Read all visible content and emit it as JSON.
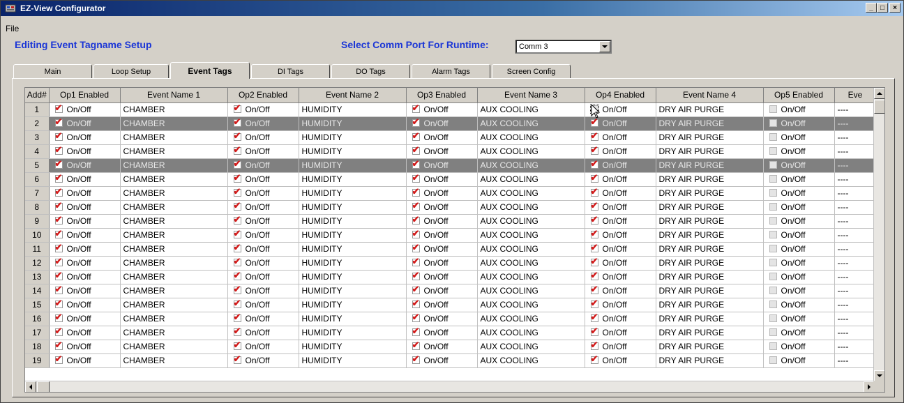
{
  "window": {
    "title": "EZ-View Configurator",
    "min": "_",
    "max": "□",
    "close": "×"
  },
  "menu": {
    "file": "File"
  },
  "header": {
    "editing_title": "Editing Event Tagname Setup",
    "comm_label": "Select Comm Port For Runtime:",
    "comm_value": "Comm 3"
  },
  "tabs": [
    "Main",
    "Loop Setup",
    "Event Tags",
    "DI Tags",
    "DO Tags",
    "Alarm Tags",
    "Screen Config"
  ],
  "active_tab": "Event Tags",
  "grid": {
    "columns": [
      "Add#",
      "Op1 Enabled",
      "Event Name 1",
      "Op2 Enabled",
      "Event Name 2",
      "Op3 Enabled",
      "Event Name 3",
      "Op4 Enabled",
      "Event Name 4",
      "Op5 Enabled",
      "Eve"
    ],
    "onoff_label": "On/Off",
    "names": [
      "CHAMBER",
      "HUMIDITY",
      "AUX COOLING",
      "DRY AIR PURGE",
      "----"
    ],
    "rows": [
      "1",
      "2",
      "3",
      "4",
      "5",
      "6",
      "7",
      "8",
      "9",
      "10",
      "11",
      "12",
      "13",
      "14",
      "15",
      "16",
      "17",
      "18",
      "19"
    ],
    "selected_rows": [
      "2",
      "5"
    ],
    "op4_unchecked_rows": [
      "1"
    ],
    "op5_checked": false
  },
  "colors": {
    "title_start": "#0a246a",
    "title_end": "#a6caf0",
    "heading": "#1a35d6",
    "check": "#d21a1a",
    "selected_row": "#808080"
  }
}
